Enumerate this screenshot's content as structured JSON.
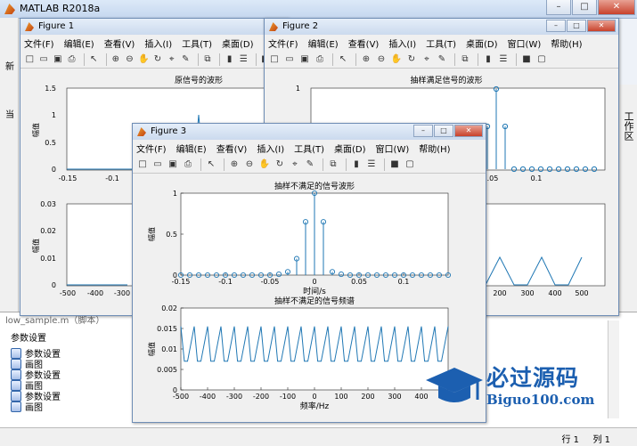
{
  "matlab": {
    "title": "MATLAB R2018a",
    "workspace_label": "工作区",
    "left_fragments": [
      "新",
      "当"
    ],
    "file_tab": "low_sample.m（脚本）",
    "panel_heading": "参数设置",
    "panel_items": [
      "参数设置",
      "画图",
      "参数设置",
      "画图",
      "参数设置",
      "画图"
    ],
    "status_row": "行 1",
    "status_col": "列 1"
  },
  "menus": [
    "文件(F)",
    "编辑(E)",
    "查看(V)",
    "插入(I)",
    "工具(T)",
    "桌面(D)",
    "窗口(W)",
    "帮助(H)"
  ],
  "toolbar_icons": [
    "new-icon",
    "open-icon",
    "save-icon",
    "print-icon",
    "sep",
    "pointer-icon",
    "sep",
    "zoom-in-icon",
    "zoom-out-icon",
    "pan-icon",
    "rotate-icon",
    "data-cursor-icon",
    "brush-icon",
    "sep",
    "link-icon",
    "sep",
    "colorbar-icon",
    "legend-icon",
    "sep",
    "hide-plot-icon",
    "show-plot-icon"
  ],
  "figures": {
    "fig1": {
      "title": "Figure 1",
      "top_plot": {
        "title": "原信号的波形",
        "ylabel": "幅值",
        "yticks": [
          "1.5",
          "1",
          "0.5",
          "0"
        ],
        "xticks": [
          "-0.15",
          "-0.1"
        ]
      },
      "bottom_plot": {
        "ylabel": "幅值",
        "yticks": [
          "0.03",
          "0.02",
          "0.01",
          "0"
        ],
        "xticks": [
          "-500",
          "-400",
          "-300"
        ]
      }
    },
    "fig2": {
      "title": "Figure 2",
      "top_plot": {
        "title": "抽样满足信号的波形",
        "ylabel": "幅",
        "yticks": [
          "1"
        ],
        "xticks": [
          ".05",
          "0.1"
        ]
      },
      "bottom_plot": {
        "xticks": [
          "200",
          "300",
          "400",
          "500"
        ]
      }
    },
    "fig3": {
      "title": "Figure 3"
    }
  },
  "chart_data": [
    {
      "type": "scatter",
      "title": "抽样不满足的信号波形",
      "xlabel": "时间/s",
      "ylabel": "幅值",
      "xlim": [
        -0.15,
        0.15
      ],
      "ylim": [
        0,
        1
      ],
      "xticks": [
        "-0.15",
        "-0.1",
        "-0.05",
        "0",
        "0.05",
        "0.1"
      ],
      "yticks": [
        "1",
        "0.5",
        "0"
      ],
      "stem": true,
      "x": [
        -0.15,
        -0.14,
        -0.13,
        -0.12,
        -0.11,
        -0.1,
        -0.09,
        -0.08,
        -0.07,
        -0.06,
        -0.05,
        -0.04,
        -0.03,
        -0.02,
        -0.01,
        0,
        0.01,
        0.02,
        0.03,
        0.04,
        0.05,
        0.06,
        0.07,
        0.08,
        0.09,
        0.1,
        0.11,
        0.12,
        0.13,
        0.14,
        0.15
      ],
      "y": [
        0,
        0,
        0,
        0,
        0,
        0,
        0,
        0,
        0,
        0,
        0,
        0.01,
        0.04,
        0.2,
        0.65,
        1,
        0.65,
        0.04,
        0.01,
        0,
        0,
        0,
        0,
        0,
        0,
        0,
        0,
        0,
        0,
        0,
        0
      ]
    },
    {
      "type": "line",
      "title": "抽样不满足的信号频谱",
      "xlabel": "频率/Hz",
      "ylabel": "幅值",
      "xlim": [
        -500,
        500
      ],
      "ylim": [
        0,
        0.02
      ],
      "xticks": [
        "-500",
        "-400",
        "-300",
        "-200",
        "-100",
        "0",
        "100",
        "200",
        "300",
        "400"
      ],
      "yticks": [
        "0.02",
        "0.015",
        "0.01",
        "0.005",
        "0"
      ],
      "x": [
        -500,
        -487,
        -475,
        -450,
        -438,
        -425,
        -400,
        -388,
        -375,
        -350,
        -338,
        -325,
        -300,
        -288,
        -275,
        -250,
        -238,
        -225,
        -200,
        -188,
        -175,
        -150,
        -138,
        -125,
        -100,
        -88,
        -75,
        -50,
        -38,
        -25,
        0,
        12,
        25,
        50,
        62,
        75,
        100,
        112,
        125,
        150,
        162,
        175,
        200,
        212,
        225,
        250,
        262,
        275,
        300,
        312,
        325,
        350,
        362,
        375,
        400,
        412,
        425,
        450,
        462,
        475,
        500
      ],
      "y": [
        0.0155,
        0.007,
        0.007,
        0.0155,
        0.007,
        0.007,
        0.0155,
        0.007,
        0.007,
        0.0155,
        0.007,
        0.007,
        0.0155,
        0.007,
        0.007,
        0.0155,
        0.007,
        0.007,
        0.0155,
        0.007,
        0.007,
        0.0155,
        0.007,
        0.007,
        0.0155,
        0.007,
        0.007,
        0.0155,
        0.007,
        0.007,
        0.0155,
        0.007,
        0.007,
        0.0155,
        0.007,
        0.007,
        0.0155,
        0.007,
        0.007,
        0.0155,
        0.007,
        0.007,
        0.0155,
        0.007,
        0.007,
        0.0155,
        0.007,
        0.007,
        0.0155,
        0.007,
        0.007,
        0.0155,
        0.007,
        0.007,
        0.0155,
        0.007,
        0.007,
        0.0155,
        0.007,
        0.007,
        0.0155
      ]
    }
  ],
  "watermark": {
    "brand": "必过源码",
    "url": "Biguo100.com"
  }
}
